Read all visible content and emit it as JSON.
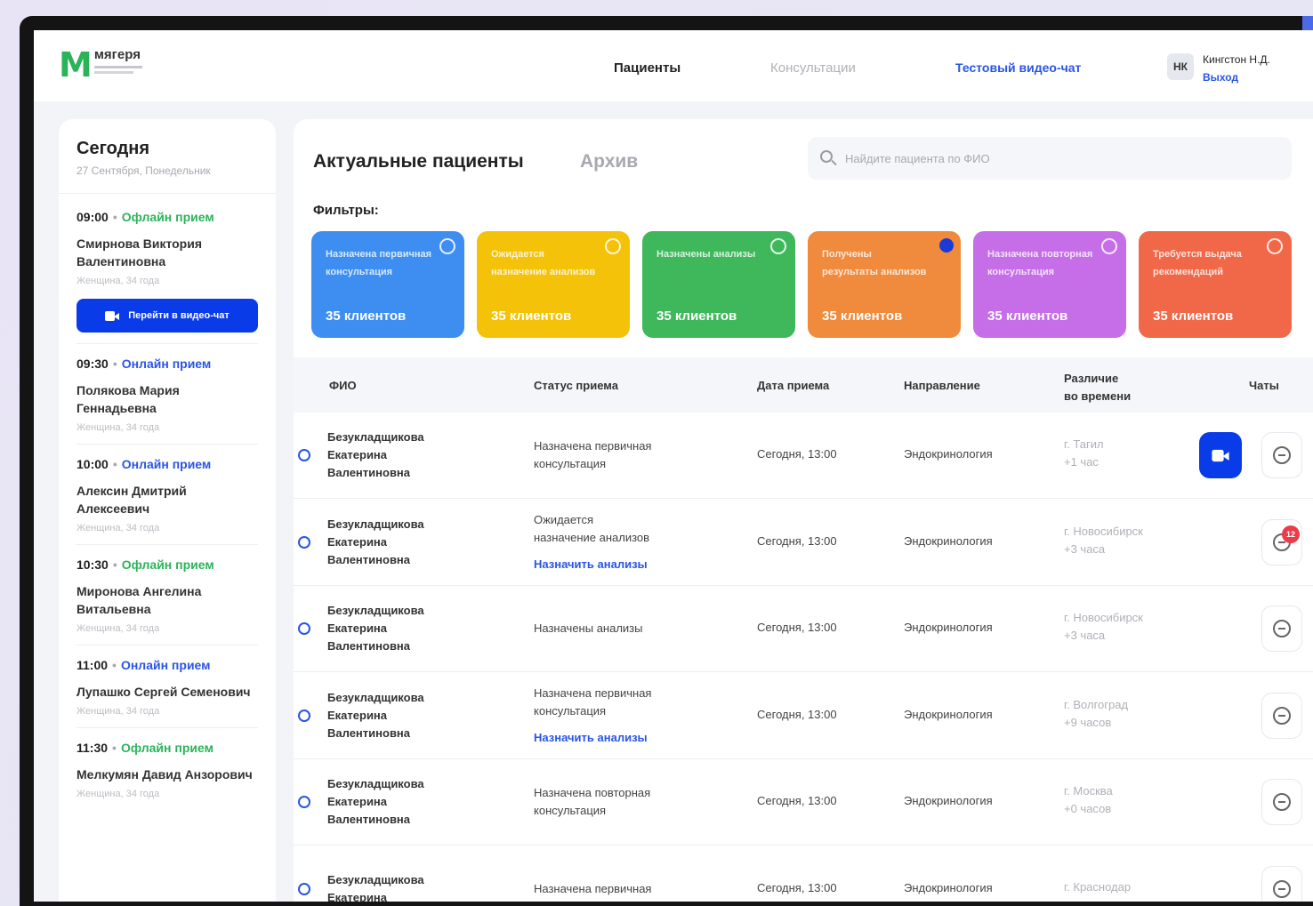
{
  "app": {
    "logo_letter": "M",
    "logo_name": "мягеря"
  },
  "header": {
    "nav": {
      "patients": "Пациенты",
      "consultations": "Консультации",
      "test_chat": "Тестовый видео-чат"
    },
    "user": {
      "initials": "НК",
      "name": "Кингстон Н.Д.",
      "logout": "Выход"
    }
  },
  "schedule": {
    "title": "Сегодня",
    "date": "27 Сентября, Понедельник",
    "video_button": "Перейти в видео-чат",
    "appointments": [
      {
        "time": "09:00",
        "type": "Офлайн прием",
        "name": "Смирнова Виктория Валентиновна",
        "meta": "Женщина, 34 года"
      },
      {
        "time": "09:30",
        "type": "Онлайн прием",
        "name": "Полякова Мария Геннадьевна",
        "meta": "Женщина, 34 года"
      },
      {
        "time": "10:00",
        "type": "Онлайн прием",
        "name": "Алексин Дмитрий Алексеевич",
        "meta": "Женщина, 34 года"
      },
      {
        "time": "10:30",
        "type": "Офлайн прием",
        "name": "Миронова Ангелина Витальевна",
        "meta": "Женщина, 34 года"
      },
      {
        "time": "11:00",
        "type": "Онлайн прием",
        "name": "Лупашко Сергей Семенович",
        "meta": "Женщина, 34 года"
      },
      {
        "time": "11:30",
        "type": "Офлайн прием",
        "name": "Мелкумян Давид Анзорович",
        "meta": "Женщина, 34 года"
      }
    ]
  },
  "main": {
    "tabs": {
      "current": "Актуальные пациенты",
      "archive": "Архив"
    },
    "search": {
      "placeholder": "Найдите пациента по ФИО"
    },
    "filters_label": "Фильтры:",
    "filters": [
      {
        "label": "Назначена первичная консультация",
        "count": "35 клиентов",
        "color": "#3d8ef0",
        "checked": false
      },
      {
        "label": "Ожидается назначение анализов",
        "count": "35 клиентов",
        "color": "#f5c20a",
        "checked": false
      },
      {
        "label": "Назначены анализы",
        "count": "35 клиентов",
        "color": "#3fb85c",
        "checked": false
      },
      {
        "label": "Получены результаты анализов",
        "count": "35 клиентов",
        "color": "#f08a3c",
        "checked": true
      },
      {
        "label": "Назначена повторная консультация",
        "count": "35 клиентов",
        "color": "#c56ee8",
        "checked": false
      },
      {
        "label": "Требуется выдача рекомендаций",
        "count": "35 клиентов",
        "color": "#f06848",
        "checked": false
      }
    ],
    "table": {
      "headers": {
        "name": "ФИО",
        "status": "Статус приема",
        "date": "Дата приема",
        "direction": "Направление",
        "diff_line1": "Различие",
        "diff_line2": "во времени",
        "chats": "Чаты"
      },
      "rows": [
        {
          "name1": "Безукладщикова",
          "name2": "Екатерина",
          "name3": "Валентиновна",
          "status1": "Назначена первичная",
          "status2": "консультация",
          "link": "",
          "date": "Сегодня, 13:00",
          "direction": "Эндокринология",
          "diff1": "г. Тагил",
          "diff2": "+1 час",
          "video": true,
          "badge": ""
        },
        {
          "name1": "Безукладщикова",
          "name2": "Екатерина",
          "name3": "Валентиновна",
          "status1": "Ожидается",
          "status2": "назначение анализов",
          "link": "Назначить анализы",
          "date": "Сегодня, 13:00",
          "direction": "Эндокринология",
          "diff1": "г. Новосибирск",
          "diff2": "+3 часа",
          "video": false,
          "badge": "12"
        },
        {
          "name1": "Безукладщикова",
          "name2": "Екатерина",
          "name3": "Валентиновна",
          "status1": "Назначены анализы",
          "status2": "",
          "link": "",
          "date": "Сегодня, 13:00",
          "direction": "Эндокринология",
          "diff1": "г. Новосибирск",
          "diff2": "+3 часа",
          "video": false,
          "badge": ""
        },
        {
          "name1": "Безукладщикова",
          "name2": "Екатерина",
          "name3": "Валентиновна",
          "status1": "Назначена первичная",
          "status2": "консультация",
          "link": "Назначить анализы",
          "date": "Сегодня, 13:00",
          "direction": "Эндокринология",
          "diff1": "г. Волгоград",
          "diff2": "+9 часов",
          "video": false,
          "badge": ""
        },
        {
          "name1": "Безукладщикова",
          "name2": "Екатерина",
          "name3": "Валентиновна",
          "status1": "Назначена повторная",
          "status2": "консультация",
          "link": "",
          "date": "Сегодня, 13:00",
          "direction": "Эндокринология",
          "diff1": "г. Москва",
          "diff2": "+0 часов",
          "video": false,
          "badge": ""
        },
        {
          "name1": "Безукладщикова",
          "name2": "Екатерина",
          "name3": "",
          "status1": "Назначена первичная",
          "status2": "",
          "link": "",
          "date": "Сегодня, 13:00",
          "direction": "Эндокринология",
          "diff1": "г. Краснодар",
          "diff2": "",
          "video": false,
          "badge": ""
        }
      ]
    }
  }
}
